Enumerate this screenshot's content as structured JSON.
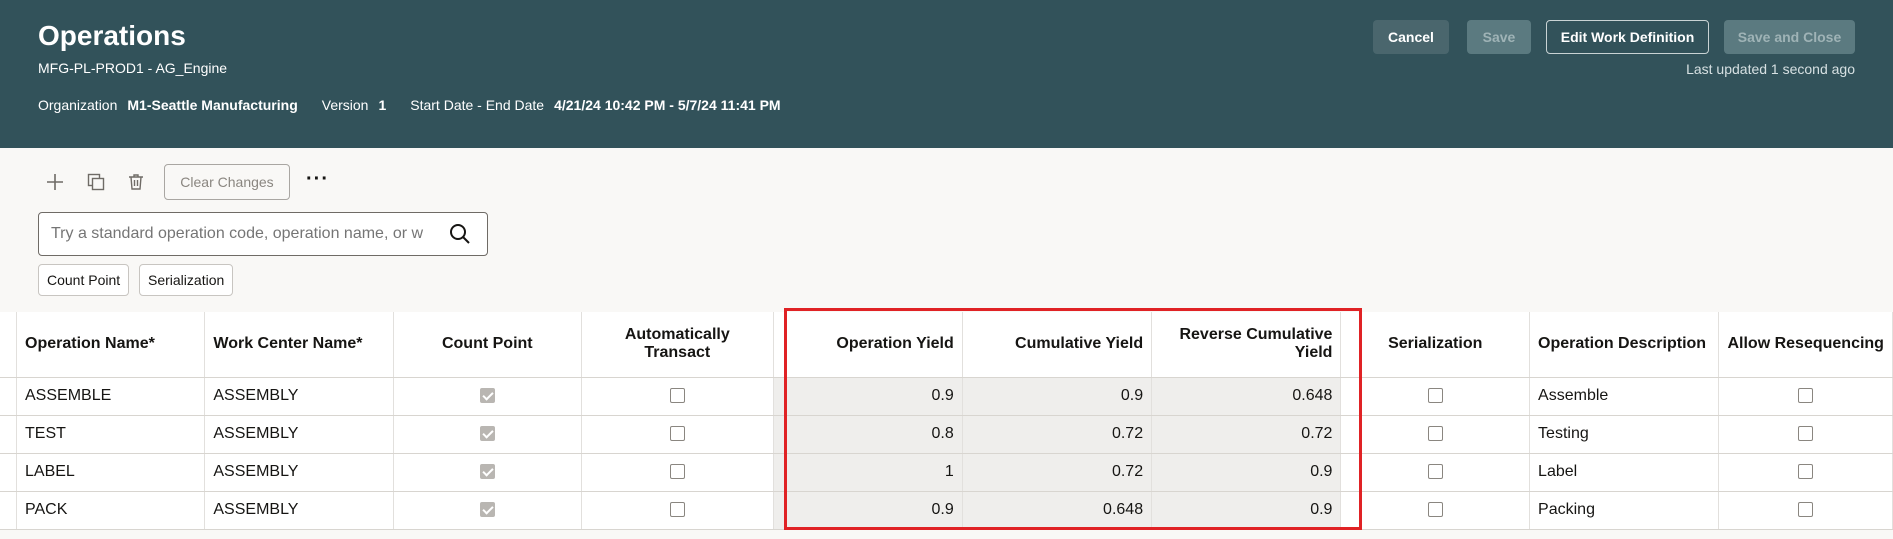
{
  "header": {
    "title": "Operations",
    "subtitle": "MFG-PL-PROD1 - AG_Engine",
    "org_label": "Organization",
    "org_value": "M1-Seattle Manufacturing",
    "version_label": "Version",
    "version_value": "1",
    "dates_label": "Start Date - End Date",
    "dates_value": "4/21/24 10:42 PM - 5/7/24 11:41 PM",
    "cancel_label": "Cancel",
    "save_label": "Save",
    "edit_label": "Edit Work Definition",
    "save_close_label": "Save and Close",
    "last_updated": "Last updated 1 second ago",
    "colors": {
      "background": "#32525a"
    }
  },
  "toolbar": {
    "icons": [
      "plus-icon",
      "duplicate-icon",
      "delete-icon"
    ],
    "clear_label": "Clear Changes",
    "more_label": "···"
  },
  "search": {
    "placeholder": "Try a standard operation code, operation name, or w"
  },
  "filters": [
    "Count Point",
    "Serialization"
  ],
  "table": {
    "columns": [
      "Operation Name*",
      "Work Center Name*",
      "Count Point",
      "Automatically Transact",
      "Operation Yield",
      "Cumulative Yield",
      "Reverse Cumulative Yield",
      "Serialization",
      "Operation Description",
      "Allow Resequencing"
    ],
    "rows": [
      {
        "name": "ASSEMBLE",
        "wc": "ASSEMBLY",
        "count_point": true,
        "auto": false,
        "yield": "0.9",
        "cum": "0.9",
        "rev": "0.648",
        "serial": false,
        "desc": "Assemble",
        "reseq": false
      },
      {
        "name": "TEST",
        "wc": "ASSEMBLY",
        "count_point": true,
        "auto": false,
        "yield": "0.8",
        "cum": "0.72",
        "rev": "0.72",
        "serial": false,
        "desc": "Testing",
        "reseq": false
      },
      {
        "name": "LABEL",
        "wc": "ASSEMBLY",
        "count_point": true,
        "auto": false,
        "yield": "1",
        "cum": "0.72",
        "rev": "0.9",
        "serial": false,
        "desc": "Label",
        "reseq": false
      },
      {
        "name": "PACK",
        "wc": "ASSEMBLY",
        "count_point": true,
        "auto": false,
        "yield": "0.9",
        "cum": "0.648",
        "rev": "0.9",
        "serial": false,
        "desc": "Packing",
        "reseq": false
      }
    ]
  },
  "highlight_color": "#e02225"
}
